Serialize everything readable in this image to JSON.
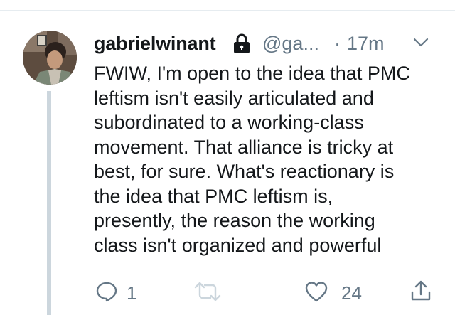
{
  "tweet": {
    "author": {
      "display_name": "gabrielwinant",
      "handle": "@ga...",
      "protected_icon": "lock-icon"
    },
    "separator": "·",
    "timestamp": "17m",
    "menu_icon": "chevron-down-icon",
    "text": "FWIW, I'm open to the idea that PMC\nleftism isn't easily articulated and\nsubordinated to a working-class\nmovement. That alliance is tricky at\nbest, for sure. What's reactionary is\nthe idea  that PMC leftism is,\npresently, the reason the working\nclass isn't organized and powerful",
    "actions": {
      "reply": {
        "icon": "reply-icon",
        "count": "1"
      },
      "retweet": {
        "icon": "retweet-icon",
        "count": ""
      },
      "like": {
        "icon": "heart-icon",
        "count": "24"
      },
      "share": {
        "icon": "share-icon"
      }
    }
  },
  "colors": {
    "text_primary": "#14171a",
    "text_secondary": "#657786",
    "thread_line": "#ccd6dd",
    "retweet_icon": "#ccd6dd",
    "divider": "#e6ecf0"
  }
}
